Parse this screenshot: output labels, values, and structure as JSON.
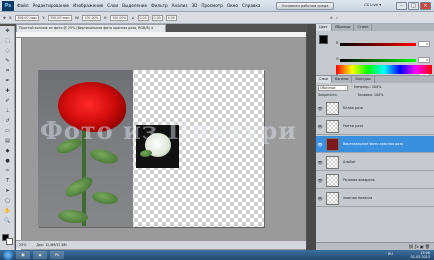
{
  "app": {
    "logo": "Ps",
    "cs_live": "CS Live ▾"
  },
  "menu": [
    "Файл",
    "Редактирование",
    "Изображение",
    "Слои",
    "Выделение",
    "Фильтр",
    "Анализ",
    "3D",
    "Просмотр",
    "Окно",
    "Справка"
  ],
  "workspace_button": "Основная рабочая среда",
  "options_bar": {
    "x_label": "X:",
    "x_value": "306,00 пикс",
    "y_label": "Y:",
    "y_value": "350,00 пикс",
    "w_label": "W:",
    "w_value": "100,00%",
    "h_label": "H:",
    "h_value": "100,00%",
    "angle_value": "0,00",
    "h_skew": "0,00",
    "v_skew": "0,00"
  },
  "document": {
    "tab_title": "Простой коллаж из фото @ 25% (Вертикальное фото красная роза, RGB/8) ×",
    "zoom": "25%",
    "doc_info": "Док: 12,6М/37,6М"
  },
  "watermark_text": "Фото из Пиктури",
  "panels": {
    "top_tabs": [
      "Цвет",
      "Образцы",
      "Стили"
    ],
    "sliders": [
      {
        "label": "R",
        "value": "0",
        "color": "#ff0000"
      },
      {
        "label": "G",
        "value": "0",
        "color": "#00c000"
      },
      {
        "label": "B",
        "value": "0",
        "color": "#0000ff"
      }
    ],
    "layers_tabs": [
      "Слои",
      "Каналы",
      "Контуры"
    ],
    "blend_mode": "Обычные",
    "opacity_label": "Непрозр.: 100%",
    "lock_label": "Закрепить:",
    "fill_label": "Заливка: 100%",
    "layers": [
      {
        "name": "Белая роза",
        "selected": false
      },
      {
        "name": "Нитки роза",
        "selected": false
      },
      {
        "name": "Вертикальное фото красная роза",
        "selected": true
      },
      {
        "name": "Альбит",
        "selected": false
      },
      {
        "name": "Розовая акварель",
        "selected": false
      },
      {
        "name": "нижняя полоска",
        "selected": false
      }
    ]
  },
  "taskbar": {
    "time": "13:06",
    "date": "01.03.2013",
    "lang": "RU"
  }
}
